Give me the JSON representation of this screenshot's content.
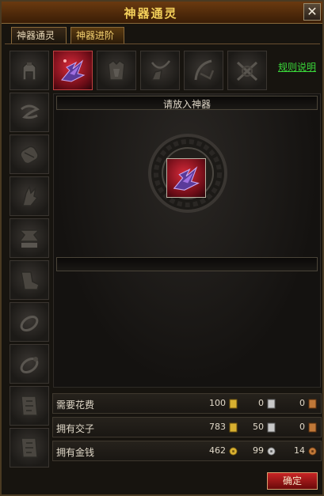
{
  "window": {
    "title": "神器通灵"
  },
  "tabs": [
    {
      "label": "神器通灵",
      "active": false
    },
    {
      "label": "神器进阶",
      "active": true
    }
  ],
  "rules_link": "规则说明",
  "top_slots": [
    {
      "icon": "helmet-icon",
      "selected": false
    },
    {
      "icon": "artifact-red-crystal-icon",
      "selected": true
    },
    {
      "icon": "armor-icon",
      "selected": false
    },
    {
      "icon": "necklace-icon",
      "selected": false
    },
    {
      "icon": "bow-icon",
      "selected": false
    },
    {
      "icon": "crossbow-icon",
      "selected": false
    }
  ],
  "side_slots": [
    {
      "icon": "scroll-rune-icon"
    },
    {
      "icon": "gauntlet-icon"
    },
    {
      "icon": "glove-icon"
    },
    {
      "icon": "rune-block-icon"
    },
    {
      "icon": "boots-icon"
    },
    {
      "icon": "ring-icon"
    },
    {
      "icon": "ring-icon"
    },
    {
      "icon": "talisman-icon"
    },
    {
      "icon": "talisman-icon"
    }
  ],
  "main": {
    "prompt": "请放入神器",
    "bottom_bar": ""
  },
  "costs": [
    {
      "label": "需要花费",
      "values": [
        "100",
        "0",
        "0"
      ]
    },
    {
      "label": "拥有交子",
      "values": [
        "783",
        "50",
        "0"
      ]
    },
    {
      "label": "拥有金钱",
      "values": [
        "462",
        "99",
        "14"
      ]
    }
  ],
  "currency_icons": [
    "gold-ticket-icon",
    "silver-ticket-icon",
    "copper-ticket-icon",
    "gold-coin-icon",
    "silver-coin-icon",
    "copper-coin-icon"
  ],
  "confirm": "确定",
  "colors": {
    "title": "#f3cf5a",
    "link": "#3ad83a",
    "button": "#c82424"
  }
}
